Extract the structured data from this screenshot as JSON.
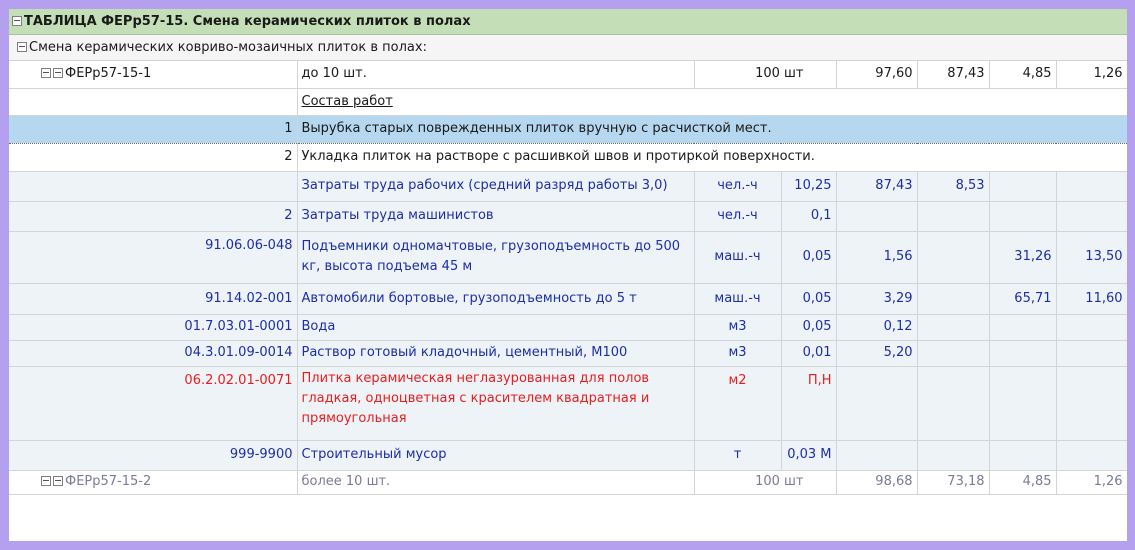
{
  "header": {
    "title": "ТАБЛИЦА ФЕРр57-15. Смена керамических плиток в полах"
  },
  "section": {
    "title": "Смена керамических ковриво-мозаичных плиток в полах:"
  },
  "item": {
    "code": "ФЕРр57-15-1",
    "name": "до 10 шт.",
    "unit": "100 шт",
    "v1": "97,60",
    "v2": "87,43",
    "v3": "4,85",
    "v4": "1,26"
  },
  "composition": {
    "title": "Состав работ",
    "steps": [
      {
        "num": "1",
        "text": "Вырубка старых поврежденных плиток вручную с расчисткой мест."
      },
      {
        "num": "2",
        "text": "Укладка плиток на растворе с расшивкой швов и протиркой поверхности."
      }
    ]
  },
  "resources": [
    {
      "code": "",
      "name": "Затраты труда рабочих (средний разряд работы 3,0)",
      "unit": "чел.-ч",
      "qty": "10,25",
      "c1": "87,43",
      "c2": "8,53",
      "c3": "",
      "c4": ""
    },
    {
      "code": "2",
      "name": "Затраты труда машинистов",
      "unit": "чел.-ч",
      "qty": "0,1",
      "c1": "",
      "c2": "",
      "c3": "",
      "c4": ""
    },
    {
      "code": "91.06.06-048",
      "name": "Подъемники одномачтовые, грузоподъемность до 500 кг, высота подъема 45 м",
      "unit": "маш.-ч",
      "qty": "0,05",
      "c1": "1,56",
      "c2": "",
      "c3": "31,26",
      "c4": "13,50"
    },
    {
      "code": "91.14.02-001",
      "name": "Автомобили бортовые, грузоподъемность до 5 т",
      "unit": "маш.-ч",
      "qty": "0,05",
      "c1": "3,29",
      "c2": "",
      "c3": "65,71",
      "c4": "11,60"
    },
    {
      "code": "01.7.03.01-0001",
      "name": "Вода",
      "unit": "м3",
      "qty": "0,05",
      "c1": "0,12",
      "c2": "",
      "c3": "",
      "c4": ""
    },
    {
      "code": "04.3.01.09-0014",
      "name": "Раствор готовый кладочный, цементный, М100",
      "unit": "м3",
      "qty": "0,01",
      "c1": "5,20",
      "c2": "",
      "c3": "",
      "c4": ""
    },
    {
      "code": "06.2.02.01-0071",
      "name": "Плитка керамическая неглазурованная для полов гладкая, одноцветная с красителем квадратная и прямоугольная",
      "unit": "м2",
      "qty": "П,Н",
      "c1": "",
      "c2": "",
      "c3": "",
      "c4": ""
    },
    {
      "code": "999-9900",
      "name": "Строительный мусор",
      "unit": "т",
      "qty": "0,03 М",
      "c1": "",
      "c2": "",
      "c3": "",
      "c4": ""
    }
  ],
  "next_item": {
    "code": "ФЕРр57-15-2",
    "name": "более 10 шт.",
    "unit": "100 шт",
    "v1": "98,68",
    "v2": "73,18",
    "v3": "4,85",
    "v4": "1,26"
  }
}
